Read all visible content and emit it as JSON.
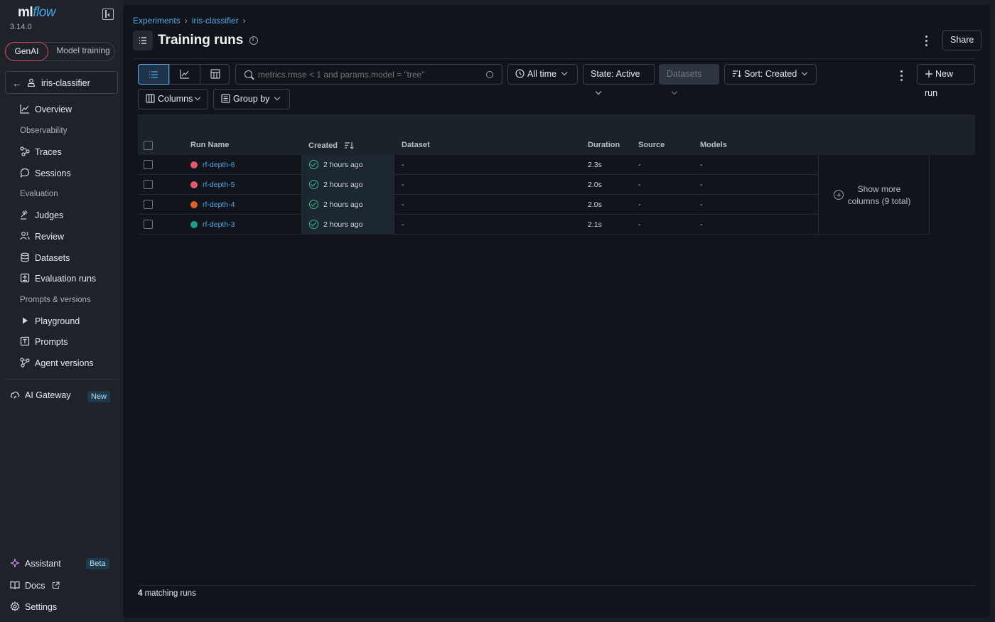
{
  "app": {
    "logo_ml": "ml",
    "logo_flow": "flow",
    "version": "3.14.0"
  },
  "mode": {
    "genai": "GenAI",
    "model_training": "Model training"
  },
  "experiment": {
    "name": "iris-classifier"
  },
  "nav": {
    "overview": "Overview",
    "observability": "Observability",
    "traces": "Traces",
    "sessions": "Sessions",
    "evaluation": "Evaluation",
    "judges": "Judges",
    "review": "Review",
    "datasets": "Datasets",
    "evaluation_runs": "Evaluation runs",
    "prompts_versions": "Prompts & versions",
    "playground": "Playground",
    "prompts": "Prompts",
    "agent_versions": "Agent versions"
  },
  "gateway": {
    "label": "AI Gateway",
    "badge": "New"
  },
  "bottom": {
    "assistant": "Assistant",
    "assistant_badge": "Beta",
    "docs": "Docs",
    "settings": "Settings"
  },
  "breadcrumb": {
    "root": "Experiments",
    "experiment": "iris-classifier",
    "sep": "›"
  },
  "page": {
    "title": "Training runs"
  },
  "header": {
    "share": "Share"
  },
  "toolbar": {
    "search_placeholder": "metrics.rmse < 1 and params.model = \"tree\"",
    "time": "All time",
    "state": "State: Active",
    "datasets": "Datasets",
    "sort": "Sort: Created",
    "new_run": "New run",
    "columns": "Columns",
    "group_by": "Group by"
  },
  "table": {
    "headers": {
      "run_name": "Run Name",
      "created": "Created",
      "dataset": "Dataset",
      "duration": "Duration",
      "source": "Source",
      "models": "Models"
    },
    "rows": [
      {
        "name": "rf-depth-6",
        "color": "#e2566c",
        "created": "2 hours ago",
        "dataset": "-",
        "duration": "2.3s",
        "source": "-",
        "models": "-"
      },
      {
        "name": "rf-depth-5",
        "color": "#e2566c",
        "created": "2 hours ago",
        "dataset": "-",
        "duration": "2.0s",
        "source": "-",
        "models": "-"
      },
      {
        "name": "rf-depth-4",
        "color": "#d9622b",
        "created": "2 hours ago",
        "dataset": "-",
        "duration": "2.0s",
        "source": "-",
        "models": "-"
      },
      {
        "name": "rf-depth-3",
        "color": "#1f9d8a",
        "created": "2 hours ago",
        "dataset": "-",
        "duration": "2.1s",
        "source": "-",
        "models": "-"
      }
    ],
    "show_more_line1": "Show more",
    "show_more_line2": "columns (9 total)"
  },
  "footer": {
    "count": "4",
    "count_label": " matching runs"
  }
}
